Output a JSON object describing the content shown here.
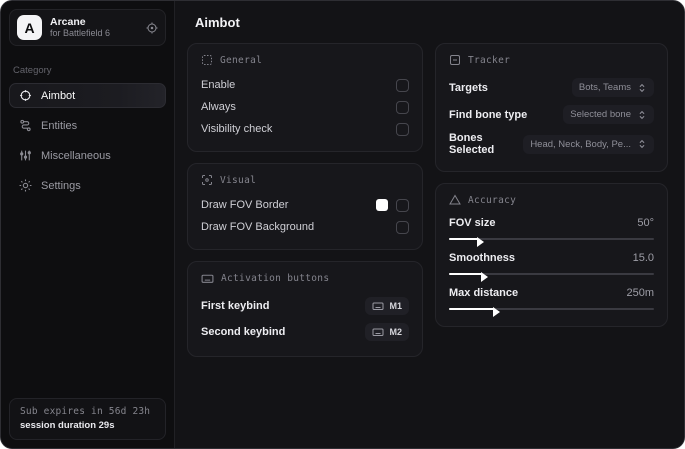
{
  "app": {
    "name": "Arcane",
    "subtitle": "for Battlefield 6",
    "logo_letter": "A"
  },
  "sidebar": {
    "category_label": "Category",
    "items": [
      {
        "label": "Aimbot",
        "icon": "crosshair-icon",
        "selected": true
      },
      {
        "label": "Entities",
        "icon": "entities-icon",
        "selected": false
      },
      {
        "label": "Miscellaneous",
        "icon": "sliders-icon",
        "selected": false
      },
      {
        "label": "Settings",
        "icon": "gear-icon",
        "selected": false
      }
    ],
    "footer": {
      "sub_expiry": "Sub expires in 56d 23h",
      "session_duration": "session duration 29s"
    }
  },
  "main": {
    "title": "Aimbot",
    "general": {
      "title": "General",
      "rows": [
        {
          "label": "Enable",
          "checked": false
        },
        {
          "label": "Always",
          "checked": false
        },
        {
          "label": "Visibility check",
          "checked": false
        }
      ]
    },
    "visual": {
      "title": "Visual",
      "rows": [
        {
          "label": "Draw FOV Border",
          "swatch_color": "#ffffff",
          "checked": false
        },
        {
          "label": "Draw FOV Background",
          "checked": false
        }
      ]
    },
    "activation": {
      "title": "Activation buttons",
      "rows": [
        {
          "label": "First keybind",
          "key": "M1"
        },
        {
          "label": "Second keybind",
          "key": "M2"
        }
      ]
    },
    "tracker": {
      "title": "Tracker",
      "rows": [
        {
          "label": "Targets",
          "value": "Bots, Teams"
        },
        {
          "label": "Find bone type",
          "value": "Selected bone"
        },
        {
          "label": "Bones Selected",
          "value": "Head, Neck, Body, Pe..."
        }
      ]
    },
    "accuracy": {
      "title": "Accuracy",
      "sliders": [
        {
          "label": "FOV size",
          "value": "50°",
          "percent": 14
        },
        {
          "label": "Smoothness",
          "value": "15.0",
          "percent": 16
        },
        {
          "label": "Max distance",
          "value": "250m",
          "percent": 22
        }
      ]
    }
  },
  "colors": {
    "accent": "#ffffff",
    "card_bg": "#17171b",
    "sidebar_bg": "#0e0e10",
    "main_bg": "#131316",
    "border": "#25252a"
  }
}
